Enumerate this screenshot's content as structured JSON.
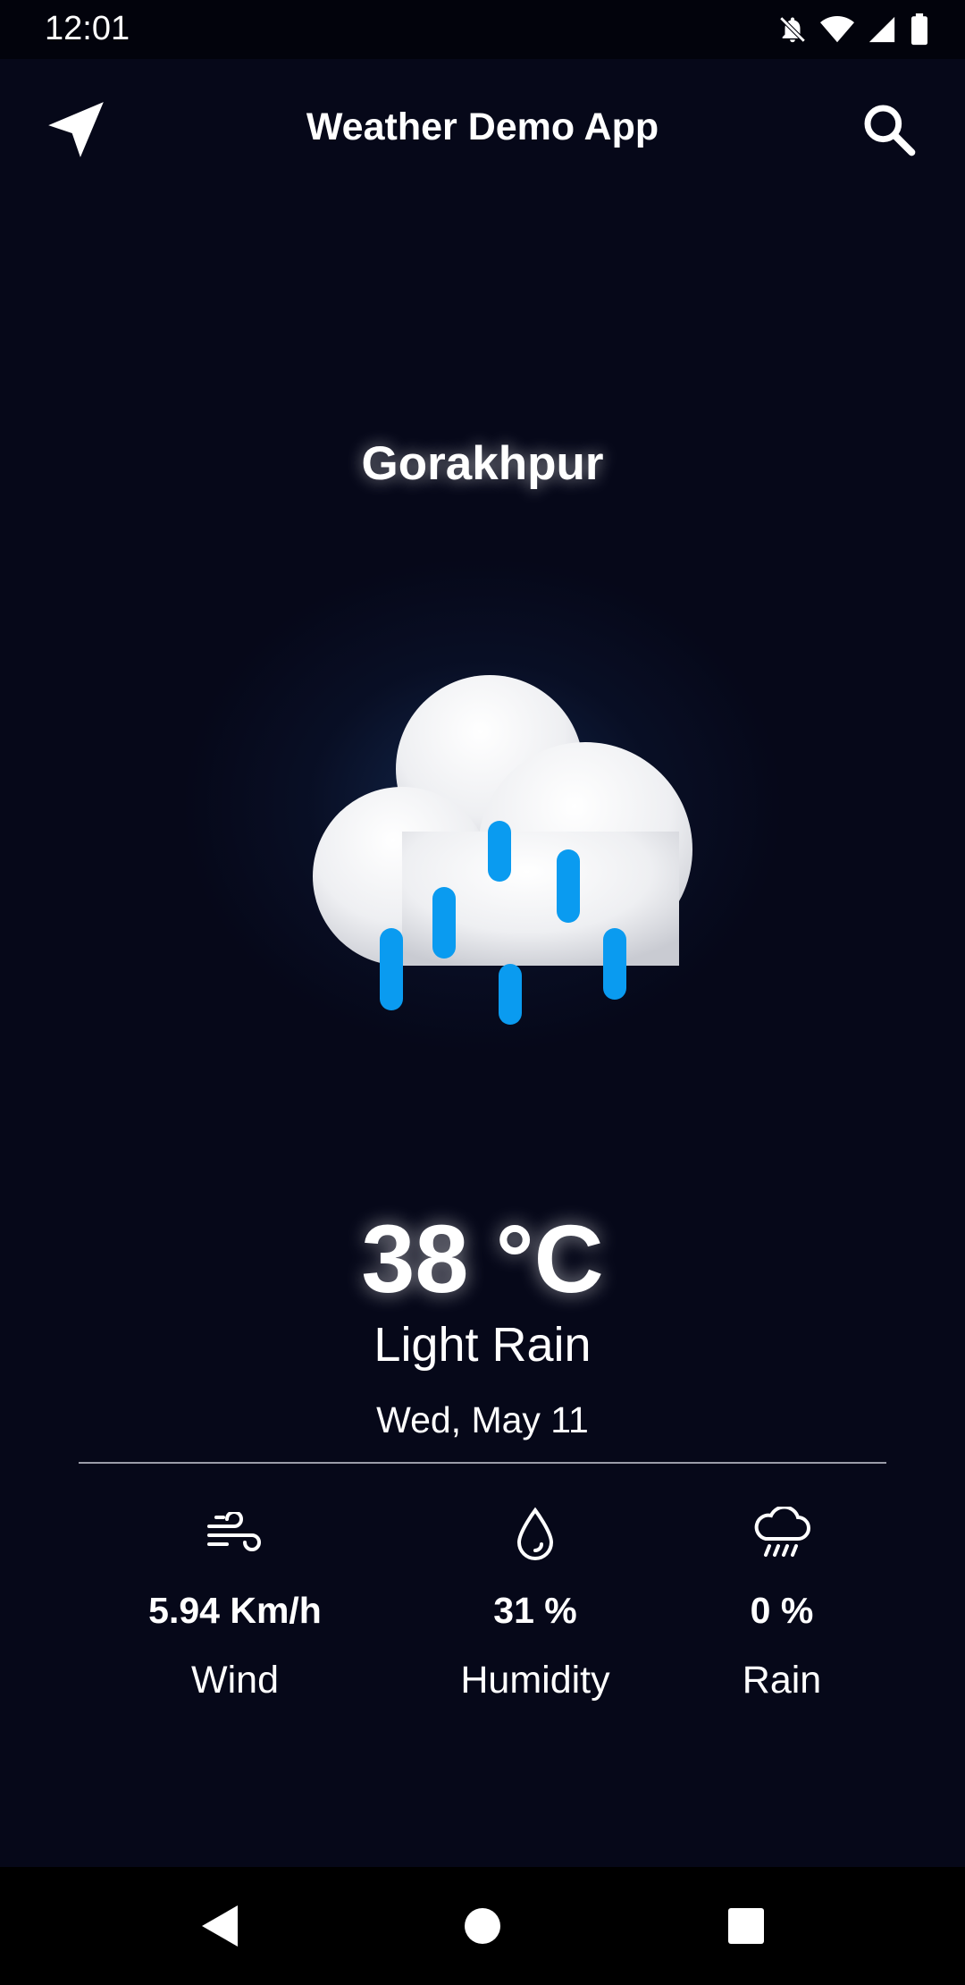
{
  "status_bar": {
    "time": "12:01",
    "icons": [
      "notifications-off-icon",
      "wifi-icon",
      "signal-icon",
      "battery-icon"
    ]
  },
  "app_bar": {
    "title": "Weather Demo App",
    "left_icon": "location-arrow-icon",
    "right_icon": "search-icon"
  },
  "weather": {
    "city": "Gorakhpur",
    "icon": "cloud-rain-icon",
    "temperature": "38 °C",
    "condition": "Light Rain",
    "date": "Wed, May 11"
  },
  "stats": [
    {
      "icon": "wind-icon",
      "value": "5.94 Km/h",
      "label": "Wind"
    },
    {
      "icon": "water-drop-icon",
      "value": "31 %",
      "label": "Humidity"
    },
    {
      "icon": "rain-cloud-icon",
      "value": "0 %",
      "label": "Rain"
    }
  ],
  "nav_bar": {
    "icons": [
      "back-icon",
      "home-icon",
      "recents-icon"
    ]
  },
  "colors": {
    "background": "#060819",
    "rain_drop": "#0a9bf0",
    "text": "#ffffff"
  }
}
